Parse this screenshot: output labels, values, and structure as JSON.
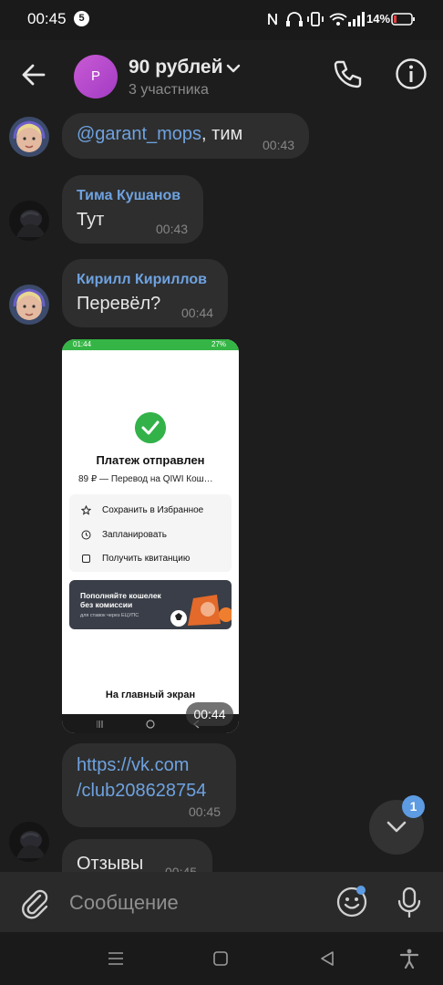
{
  "status_bar": {
    "time": "00:45",
    "notification_count": "5",
    "battery": "14%"
  },
  "header": {
    "avatar_letter": "Р",
    "title": "90 рублей",
    "subtitle": "3 участника"
  },
  "messages": [
    {
      "mention": "@garant_mops",
      "text": ", тим",
      "time": "00:43"
    },
    {
      "sender": "Тима Кушанов",
      "text": "Тут",
      "time": "00:43"
    },
    {
      "sender": "Кирилл Кириллов",
      "text": "Перевёл?",
      "time": "00:44"
    },
    {
      "time": "00:44",
      "screenshot": {
        "status_time": "01:44",
        "status_battery": "27%",
        "title": "Платеж отправлен",
        "subtitle": "89 ₽ — Перевод на QIWI Кош…",
        "actions": [
          "Сохранить в Избранное",
          "Запланировать",
          "Получить квитанцию"
        ],
        "banner_title": "Пополняйте кошелек без комиссии",
        "banner_subtitle": "для ставок через ЕЦУПС",
        "home_button": "На главный экран"
      }
    },
    {
      "link_line1": "https://vk.com",
      "link_line2": "/club208628754",
      "time": "00:45"
    },
    {
      "text": "Отзывы",
      "time": "00:45"
    }
  ],
  "scroll_button": {
    "unread": "1"
  },
  "composer": {
    "placeholder": "Сообщение"
  },
  "colors": {
    "accent": "#6ea2e0",
    "bubble": "#2e2e2e",
    "background": "#1d1d1d",
    "success": "#33b24a"
  }
}
